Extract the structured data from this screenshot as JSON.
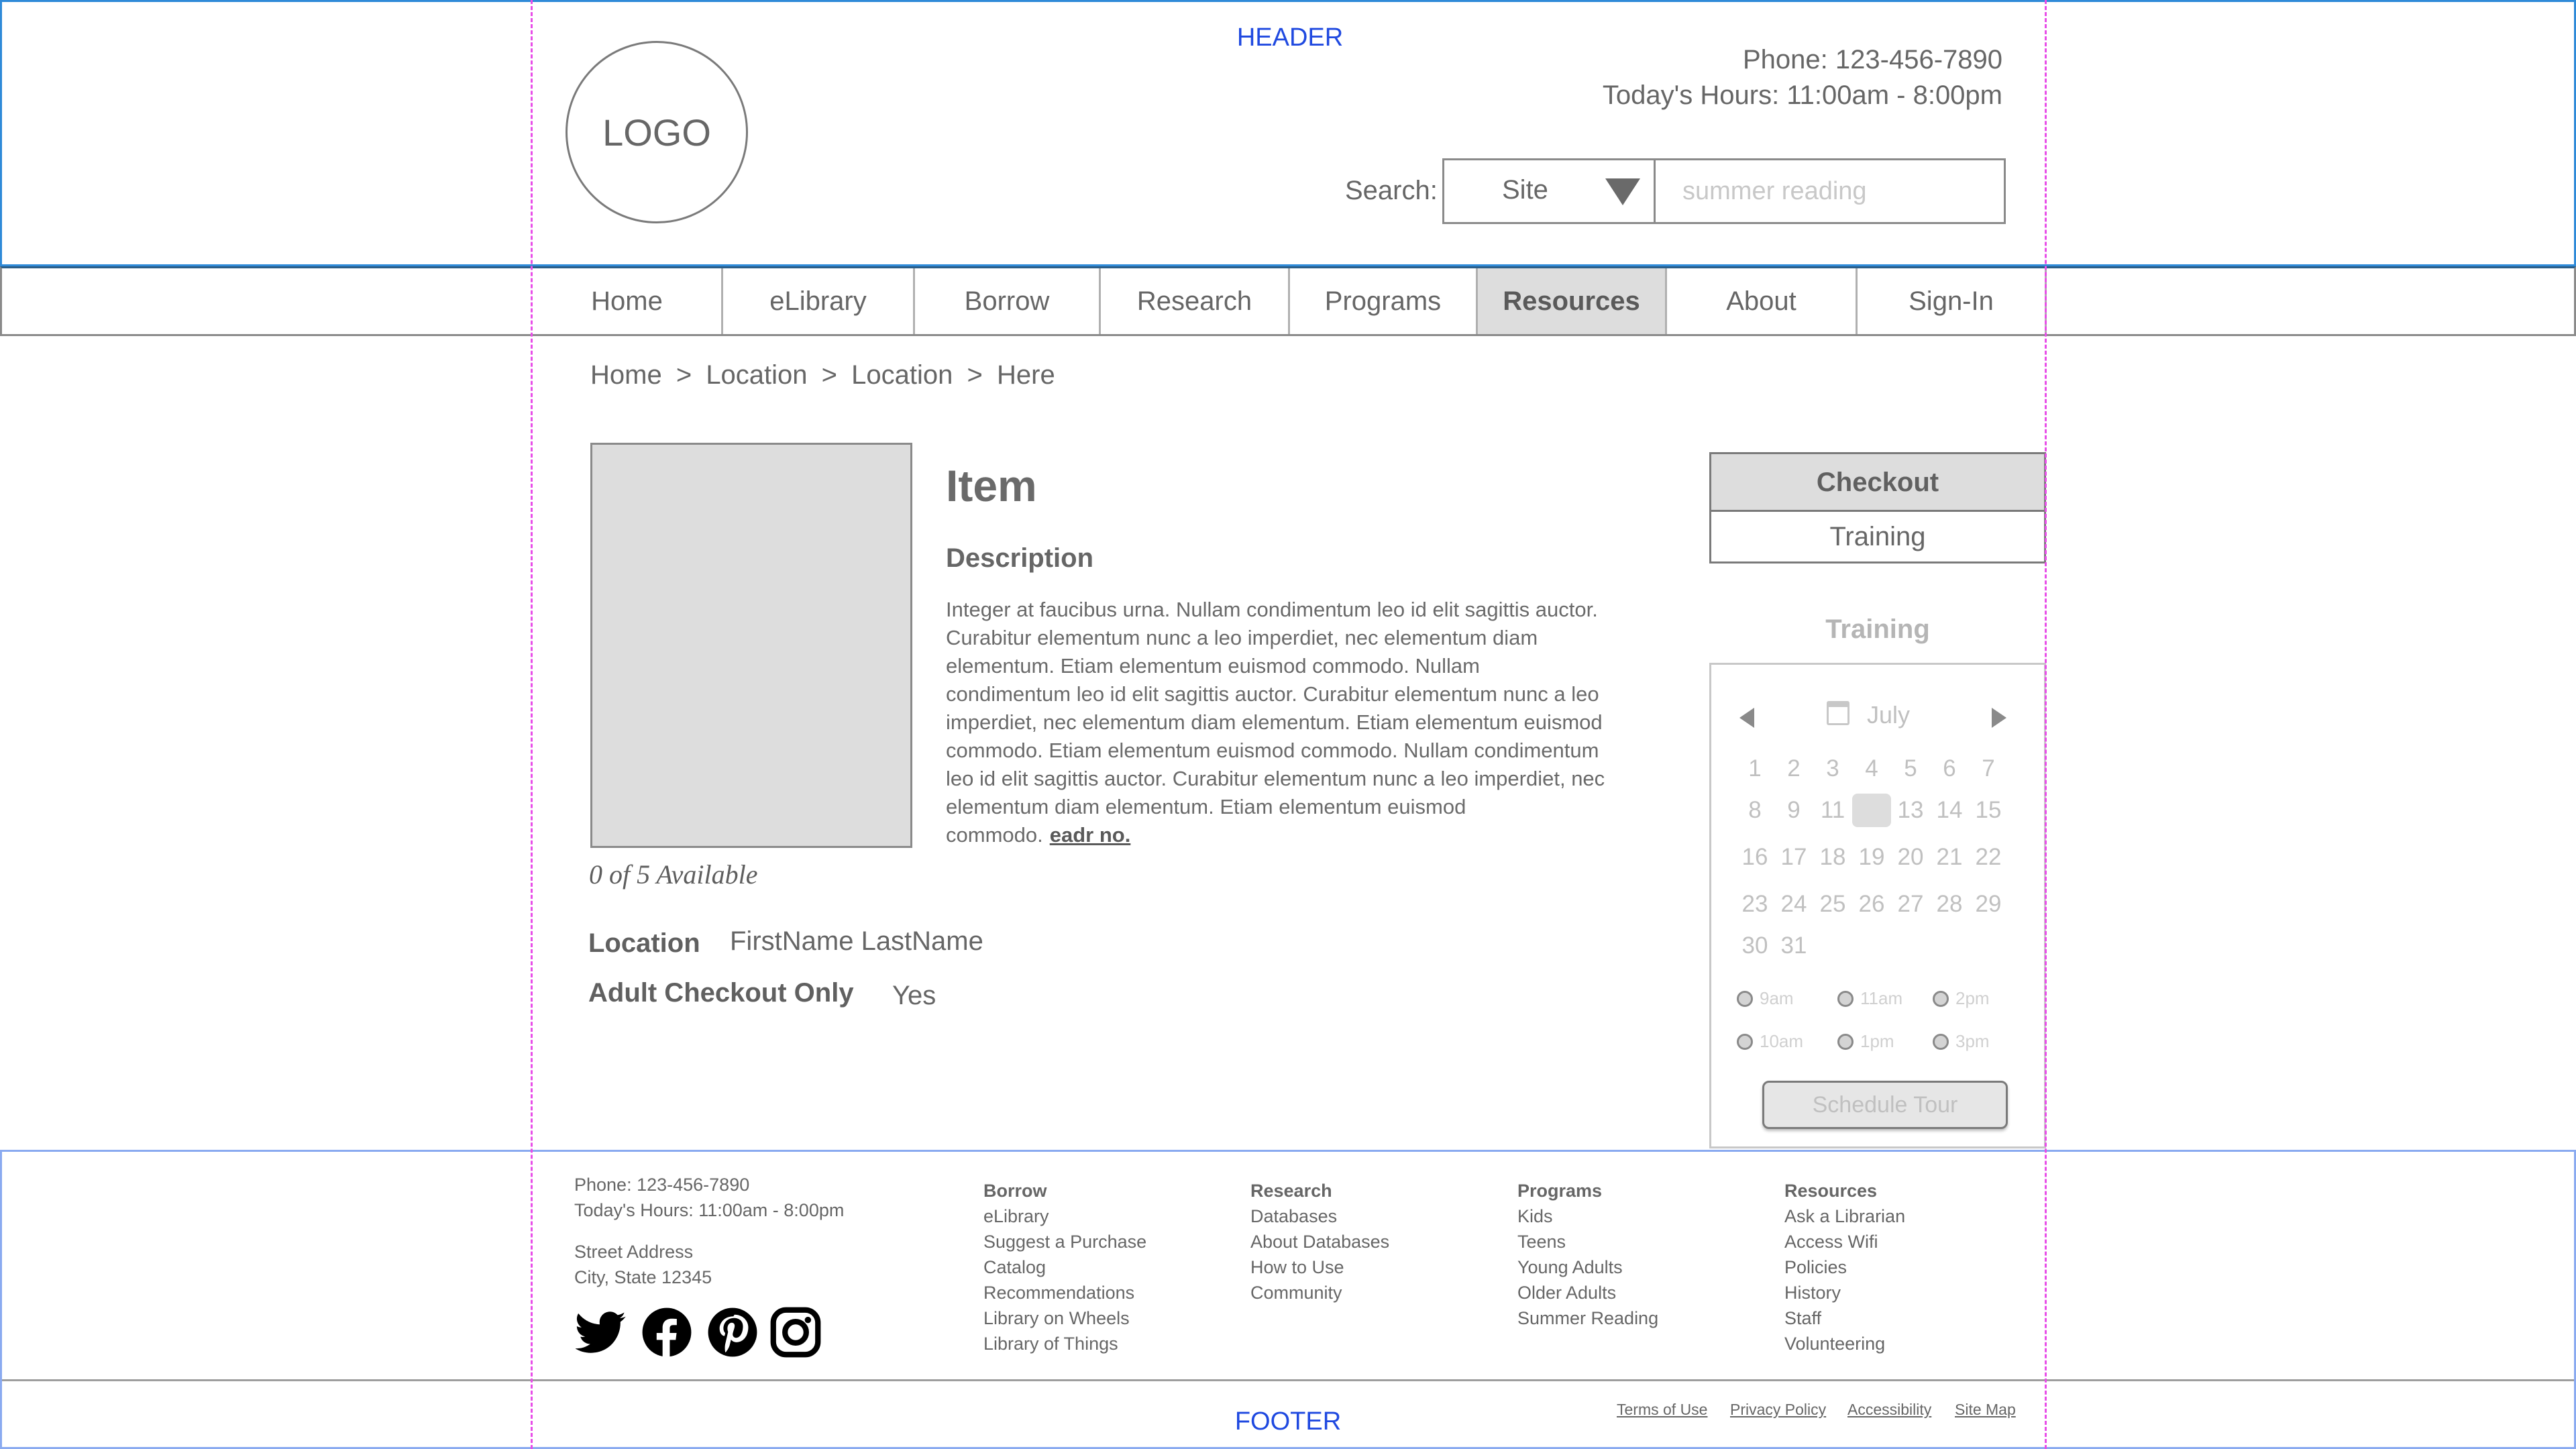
{
  "header": {
    "region_label": "HEADER",
    "logo": "LOGO",
    "phone": "Phone: 123-456-7890",
    "hours": "Today's Hours:  11:00am - 8:00pm",
    "search_label": "Search:",
    "scope_value": "Site",
    "search_placeholder": "summer reading"
  },
  "nav": {
    "items": [
      {
        "label": "Home"
      },
      {
        "label": "eLibrary"
      },
      {
        "label": "Borrow"
      },
      {
        "label": "Research"
      },
      {
        "label": "Programs"
      },
      {
        "label": "Resources",
        "active": true
      },
      {
        "label": "About"
      },
      {
        "label": "Sign-In"
      }
    ]
  },
  "breadcrumb": [
    "Home",
    "Location",
    "Location",
    "Here"
  ],
  "breadcrumb_sep": ">",
  "item": {
    "title": "Item",
    "description_heading": "Description",
    "description": "Integer at faucibus urna. Nullam condimentum leo id elit sagittis auctor. Curabitur elementum nunc a leo imperdiet, nec elementum diam elementum. Etiam elementum euismod commodo. Nullam condimentum leo id elit sagittis auctor. Curabitur elementum nunc a leo imperdiet, nec elementum diam elementum. Etiam elementum euismod commodo. Etiam elementum euismod commodo.  Nullam condimentum leo id elit sagittis auctor. Curabitur elementum nunc a leo imperdiet, nec elementum diam elementum. Etiam elementum euismod commodo.",
    "read_more": "eadr no.",
    "availability": "0 of 5 Available",
    "location_label": "Location",
    "location_value": "FirstName LastName",
    "adult_label": "Adult Checkout Only",
    "adult_value": "Yes"
  },
  "sidebar": {
    "tab_checkout": "Checkout",
    "tab_training": "Training",
    "training_heading": "Training",
    "calendar": {
      "month": "July",
      "selected_day": 12,
      "weeks": [
        [
          "1",
          "2",
          "3",
          "4",
          "5",
          "6",
          "7"
        ],
        [
          "8",
          "9",
          "11",
          "",
          "13",
          "14",
          "15"
        ],
        [
          "16",
          "17",
          "18",
          "19",
          "20",
          "21",
          "22"
        ],
        [
          "23",
          "24",
          "25",
          "26",
          "27",
          "28",
          "29"
        ],
        [
          "30",
          "31"
        ]
      ]
    },
    "times": [
      "9am",
      "11am",
      "2pm",
      "10am",
      "1pm",
      "3pm"
    ],
    "schedule_button": "Schedule Tour"
  },
  "footer": {
    "phone": "Phone: 123-456-7890",
    "hours": "Today's Hours:  11:00am - 8:00pm",
    "street": "Street Address",
    "city": "City, State 12345",
    "columns": [
      {
        "heading": "Borrow",
        "links": [
          "eLibrary",
          "Suggest a Purchase",
          "Catalog",
          "Recommendations",
          "Library on Wheels",
          "Library of Things"
        ]
      },
      {
        "heading": "Research",
        "links": [
          "Databases",
          "About Databases",
          "How to Use",
          "Community"
        ]
      },
      {
        "heading": "Programs",
        "links": [
          "Kids",
          "Teens",
          "Young Adults",
          "Older Adults",
          "Summer Reading"
        ]
      },
      {
        "heading": "Resources",
        "links": [
          "Ask a Librarian",
          "Access Wifi",
          "Policies",
          "History",
          "Staff",
          "Volunteering"
        ]
      }
    ],
    "social": [
      "twitter-icon",
      "facebook-icon",
      "pinterest-icon",
      "instagram-icon"
    ],
    "region_label": "FOOTER",
    "legal": [
      "Terms of Use",
      "Privacy Policy",
      "Accessibility",
      "Site Map"
    ]
  },
  "colors": {
    "header_border": "#2f8ad8",
    "label_blue": "#1f49e0",
    "guide_magenta": "#e84ee8",
    "active_tab": "#dddddd"
  }
}
